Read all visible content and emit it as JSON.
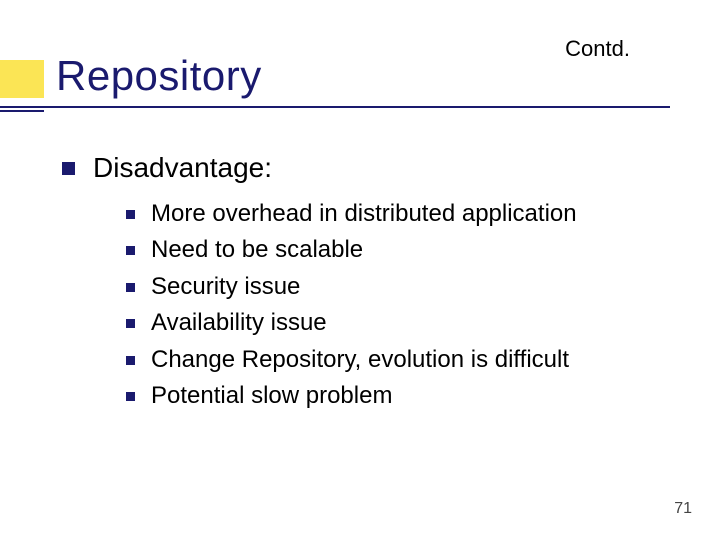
{
  "header": {
    "contd": "Contd.",
    "title": "Repository"
  },
  "content": {
    "section_label": "Disadvantage:",
    "items": [
      "More overhead in distributed application",
      "Need to be scalable",
      "Security issue",
      "Availability issue",
      "Change Repository, evolution is difficult",
      "Potential slow problem"
    ]
  },
  "page_number": "71"
}
